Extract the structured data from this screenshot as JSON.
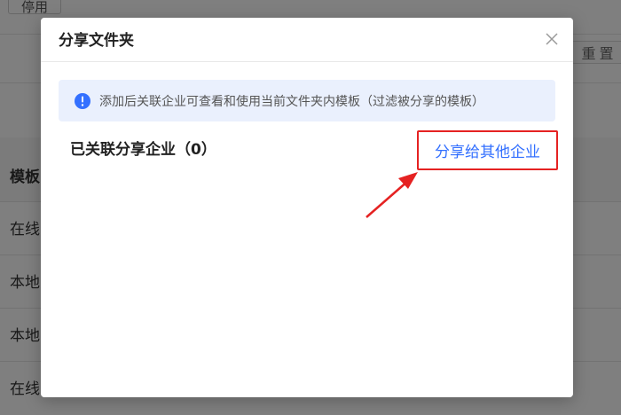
{
  "background": {
    "disable_button": "停用",
    "reset_button": "重置",
    "table": {
      "header_cell": "模板",
      "rows": [
        "在线",
        "本地",
        "本地",
        "在线"
      ]
    }
  },
  "modal": {
    "title": "分享文件夹",
    "info_text": "添加后关联企业可查看和使用当前文件夹内模板（过滤被分享的模板）",
    "linked_label": "已关联分享企业（0）",
    "share_link": "分享给其他企业"
  },
  "colors": {
    "link_blue": "#3370ff",
    "highlight_red": "#e52222",
    "info_bg": "#eaf0fd",
    "info_icon": "#3370ff"
  },
  "icons": {
    "close": "close-icon",
    "info": "info-icon"
  }
}
